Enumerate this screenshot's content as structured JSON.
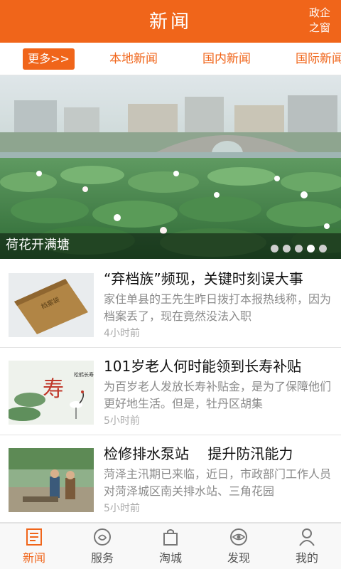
{
  "header": {
    "title": "新闻",
    "right_label_line1": "政企",
    "right_label_line2": "之窗"
  },
  "categories": {
    "more_label": "更多>>",
    "tabs": [
      "本地新闻",
      "国内新闻",
      "国际新闻"
    ]
  },
  "banner": {
    "caption": "荷花开满塘",
    "slide_count": 5,
    "active_slide": 4
  },
  "news": [
    {
      "title": "“弃档族”频现，关键时刻误大事",
      "summary": "家住单县的王先生昨日拨打本报热线称，因为档案丢了，现在竟然没法入职",
      "time": "4小时前",
      "thumb_text": "档案袋"
    },
    {
      "title": "101岁老人何时能领到长寿补贴",
      "summary": "为百岁老人发放长寿补贴金，是为了保障他们更好地生活。但是，牡丹区胡集",
      "time": "5小时前",
      "thumb_text": "寿",
      "thumb_text2": "松鹤长寿"
    },
    {
      "title": "检修排水泵站　 提升防汛能力",
      "summary": "菏泽主汛期已来临，近日，市政部门工作人员对菏泽城区南关排水站、三角花园",
      "time": "5小时前"
    }
  ],
  "bottom_nav": {
    "items": [
      {
        "label": "新闻",
        "icon": "news-icon",
        "active": true
      },
      {
        "label": "服务",
        "icon": "service-icon",
        "active": false
      },
      {
        "label": "淘城",
        "icon": "shopping-bag-icon",
        "active": false
      },
      {
        "label": "发现",
        "icon": "discover-eye-icon",
        "active": false
      },
      {
        "label": "我的",
        "icon": "person-icon",
        "active": false
      }
    ]
  },
  "colors": {
    "accent": "#f0651a",
    "text_primary": "#111111",
    "text_secondary": "#8a8a8a"
  }
}
